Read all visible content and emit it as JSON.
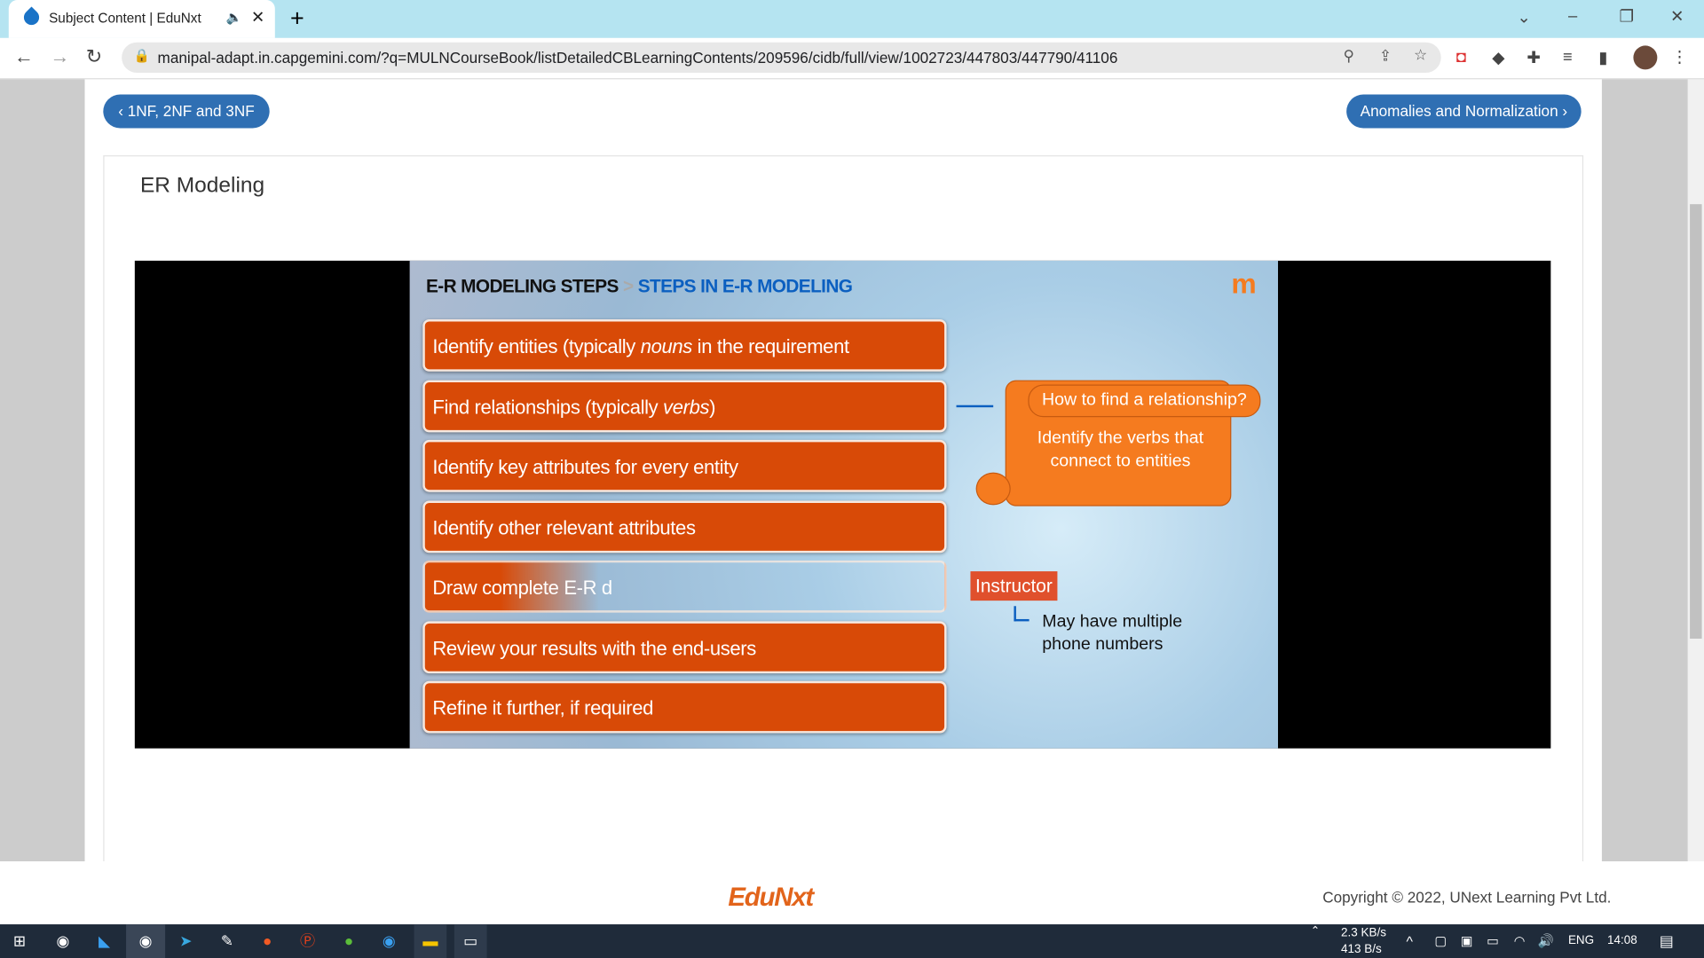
{
  "browser": {
    "tab_title": "Subject Content | EduNxt",
    "url": "manipal-adapt.in.capgemini.com/?q=MULNCourseBook/listDetailedCBLearningContents/209596/cidb/full/view/1002723/447803/447790/41106"
  },
  "nav": {
    "prev_label": "‹ 1NF, 2NF and 3NF",
    "next_label": "Anomalies and Normalization ›"
  },
  "page_title": "ER Modeling",
  "slide": {
    "breadcrumb_main": "E-R MODELING STEPS",
    "breadcrumb_sep": ">",
    "breadcrumb_sub": "STEPS IN E-R MODELING",
    "steps": [
      {
        "before": "Identify entities (typically ",
        "em": "nouns",
        "after": " in the requirement statements)"
      },
      {
        "before": "Find relationships (typically ",
        "em": "verbs",
        "after": ")"
      },
      {
        "before": "Identify key attributes for every entity",
        "em": "",
        "after": ""
      },
      {
        "before": "Identify other relevant attributes",
        "em": "",
        "after": ""
      },
      {
        "before": "Draw complete E-R d",
        "em": "",
        "after": ""
      },
      {
        "before": "Review your results with the end-users",
        "em": "",
        "after": ""
      },
      {
        "before": "Refine it further, if required",
        "em": "",
        "after": ""
      }
    ],
    "scroll_title": "How to find a relationship?",
    "scroll_body": "Identify the verbs that connect to entities",
    "instructor_label": "Instructor",
    "instructor_note": "May have multiple phone numbers"
  },
  "footer": {
    "logo": "EduNxt",
    "copyright": "Copyright © 2022, UNext Learning Pvt Ltd."
  },
  "taskbar": {
    "net_up": "2.3 KB/s",
    "net_down": "413 B/s",
    "lang": "ENG",
    "time": "14:08"
  },
  "colors": {
    "accent": "#2f6fb3",
    "step_orange": "#d84a07",
    "scroll_orange": "#f57b1f"
  }
}
